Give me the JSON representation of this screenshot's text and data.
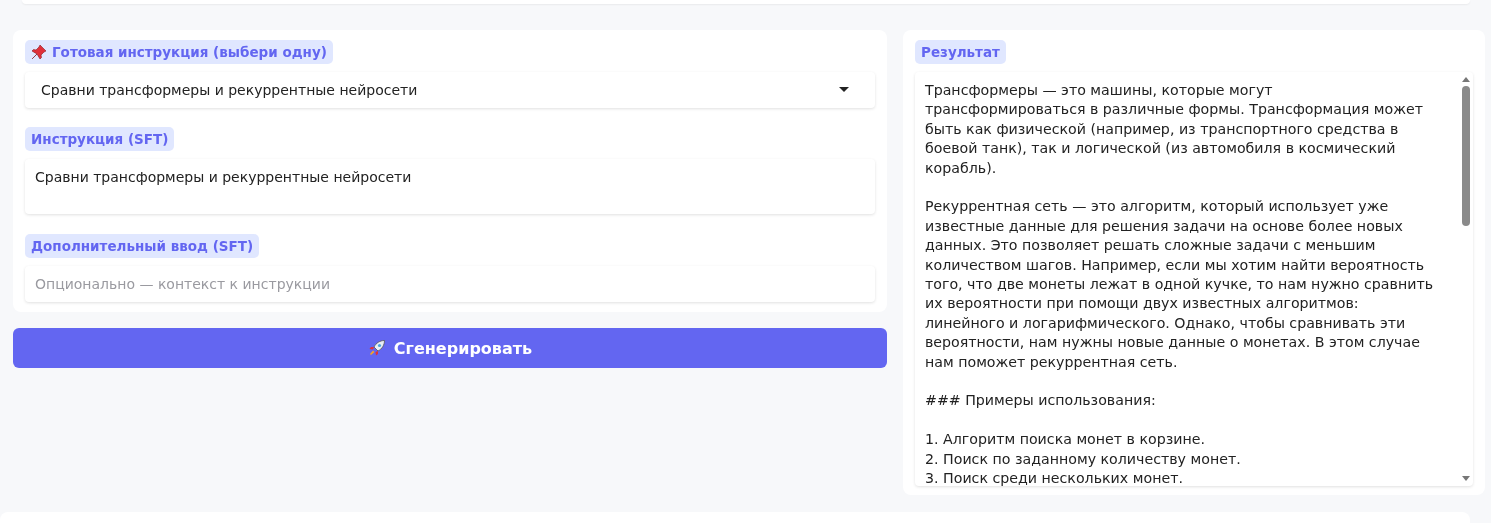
{
  "preset": {
    "label": "Готовая инструкция (выбери одну)",
    "value": "Сравни трансформеры и рекуррентные нейросети"
  },
  "instruction": {
    "label": "Инструкция (SFT)",
    "value": "Сравни трансформеры и рекуррентные нейросети"
  },
  "extra_input": {
    "label": "Дополнительный ввод (SFT)",
    "placeholder": "Опционально — контекст к инструкции"
  },
  "generate_button": {
    "label": "Сгенерировать"
  },
  "result": {
    "label": "Результат",
    "sections": [
      {
        "lines": [
          "Трансформеры — это машины, которые могут трансформироваться в различные формы. Трансформация может быть как физической (например, из транспортного средства в боевой танк), так и логической (из автомобиля в космический корабль)."
        ]
      },
      {
        "lines": [
          "Рекуррентная сеть — это алгоритм, который использует уже известные данные для решения задачи на основе более новых данных. Это позволяет решать сложные задачи с меньшим количеством шагов. Например, если мы хотим найти вероятность того, что две монеты лежат в одной кучке, то нам нужно сравнить их вероятности при помощи двух известных алгоритмов: линейного и логарифмического. Однако, чтобы сравнивать эти вероятности, нам нужны новые данные о монетах. В этом случае нам поможет рекуррентная сеть."
        ]
      },
      {
        "lines": [
          "### Примеры использования:"
        ]
      },
      {
        "lines": [
          "1. Алгоритм поиска монет в корзине.",
          "2. Поиск по заданному количеству монет.",
          "3. Поиск среди нескольких монет."
        ]
      }
    ]
  }
}
